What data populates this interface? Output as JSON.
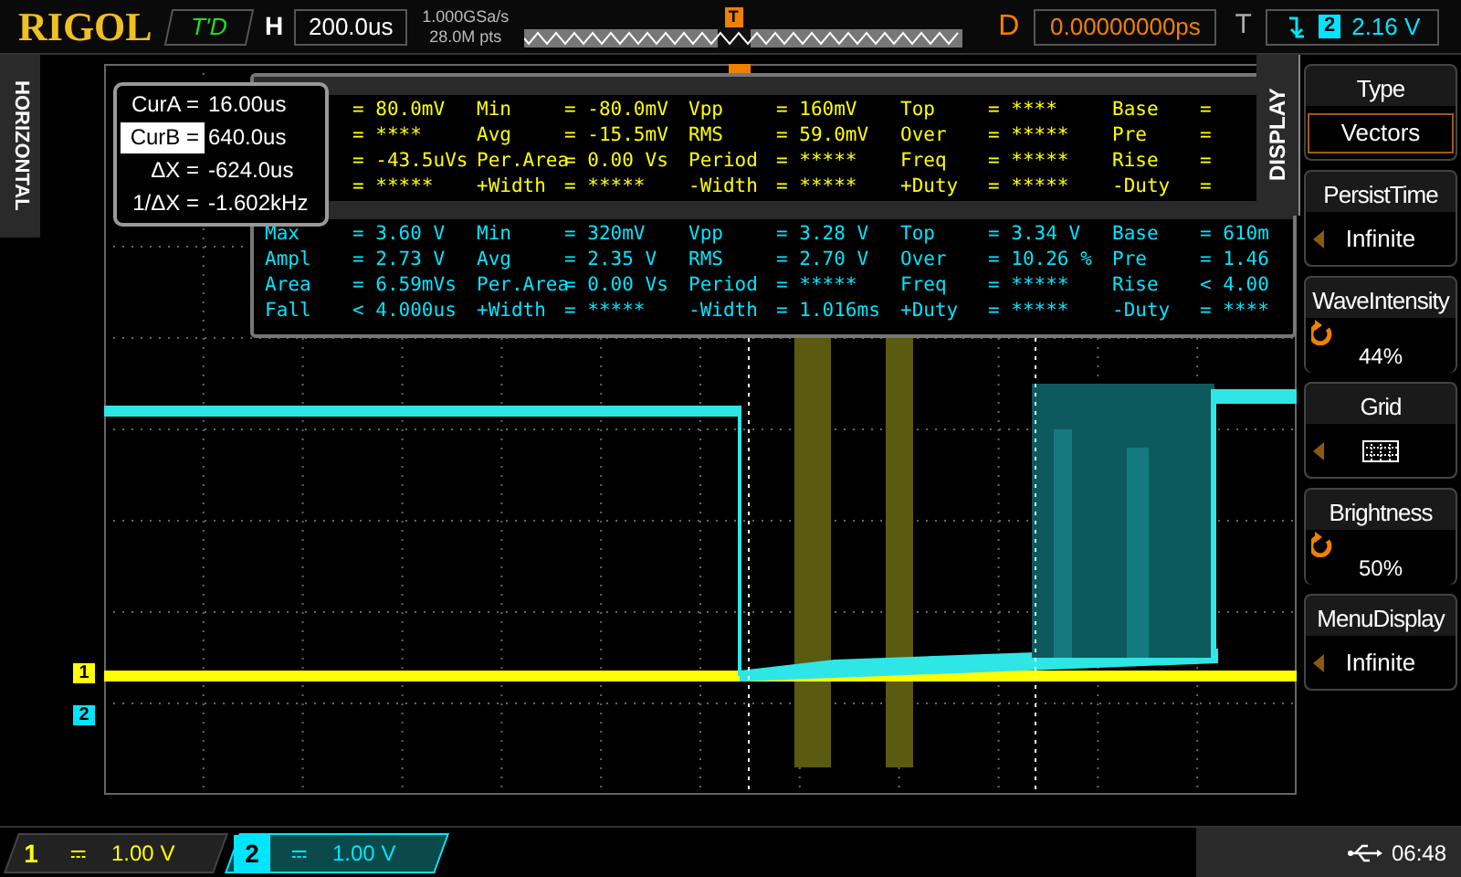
{
  "top_bar": {
    "logo": "RIGOL",
    "trigger_status": "T'D",
    "timebase_label": "H",
    "timebase": "200.0us",
    "sample_rate": "1.000GSa/s",
    "memory_depth": "28.0M pts",
    "trigger_marker": "T",
    "delay_label": "D",
    "delay": "0.00000000ps",
    "trigger_label": "T",
    "trigger_source": "2",
    "trigger_level": "2.16 V"
  },
  "side_tab": "HORIZONTAL",
  "channel_markers": [
    {
      "label": "1",
      "color": "#ffff00"
    },
    {
      "label": "2",
      "color": "#00e5ff"
    }
  ],
  "cursor_readout": [
    {
      "label": "CurA =",
      "value": "16.00us",
      "selected": false
    },
    {
      "label": "CurB =",
      "value": "640.0us",
      "selected": true
    },
    {
      "label": "ΔX =",
      "value": "-624.0us",
      "selected": false
    },
    {
      "label": "1/ΔX =",
      "value": "-1.602kHz",
      "selected": false
    }
  ],
  "measurements": [
    {
      "color": "#ffff00",
      "rows": [
        [
          {
            "value": "= 80.0mV"
          },
          {
            "label": "Min",
            "value": "= -80.0mV"
          },
          {
            "label": "Vpp",
            "value": "= 160mV"
          },
          {
            "label": "Top",
            "value": "= ****"
          },
          {
            "label": "Base",
            "value": "="
          }
        ],
        [
          {
            "value": "= ****"
          },
          {
            "label": "Avg",
            "value": "= -15.5mV"
          },
          {
            "label": "RMS",
            "value": "= 59.0mV"
          },
          {
            "label": "Over",
            "value": "= *****"
          },
          {
            "label": "Pre",
            "value": "="
          }
        ],
        [
          {
            "value": "= -43.5uVs"
          },
          {
            "label": "Per.Area",
            "value": "= 0.00 Vs"
          },
          {
            "label": "Period",
            "value": "= *****"
          },
          {
            "label": "Freq",
            "value": "= *****"
          },
          {
            "label": "Rise",
            "value": "="
          }
        ],
        [
          {
            "value": "= *****"
          },
          {
            "label": "+Width",
            "value": "= *****"
          },
          {
            "label": "-Width",
            "value": "= *****"
          },
          {
            "label": "+Duty",
            "value": "= *****"
          },
          {
            "label": "-Duty",
            "value": "="
          }
        ]
      ]
    },
    {
      "color": "#00e5ff",
      "rows": [
        [
          {
            "label": "Max",
            "value": "= 3.60 V"
          },
          {
            "label": "Min",
            "value": "= 320mV"
          },
          {
            "label": "Vpp",
            "value": "= 3.28 V"
          },
          {
            "label": "Top",
            "value": "= 3.34 V"
          },
          {
            "label": "Base",
            "value": "= 610m"
          }
        ],
        [
          {
            "label": "Ampl",
            "value": "= 2.73 V"
          },
          {
            "label": "Avg",
            "value": "= 2.35 V"
          },
          {
            "label": "RMS",
            "value": "= 2.70 V"
          },
          {
            "label": "Over",
            "value": "= 10.26 %"
          },
          {
            "label": "Pre",
            "value": "= 1.46"
          }
        ],
        [
          {
            "label": "Area",
            "value": "= 6.59mVs"
          },
          {
            "label": "Per.Area",
            "value": "= 0.00 Vs"
          },
          {
            "label": "Period",
            "value": "= *****"
          },
          {
            "label": "Freq",
            "value": "= *****"
          },
          {
            "label": "Rise",
            "value": "< 4.00"
          }
        ],
        [
          {
            "label": "Fall",
            "value": "< 4.000us"
          },
          {
            "label": "+Width",
            "value": "= *****"
          },
          {
            "label": "-Width",
            "value": "= 1.016ms"
          },
          {
            "label": "+Duty",
            "value": "= *****"
          },
          {
            "label": "-Duty",
            "value": "= ****"
          }
        ]
      ]
    }
  ],
  "menu": {
    "tab": "DISPLAY",
    "items": [
      {
        "title": "Type",
        "kind": "boxed",
        "value": "Vectors"
      },
      {
        "title": "PersistTime",
        "kind": "option",
        "value": "Infinite"
      },
      {
        "title": "WaveIntensity",
        "kind": "knob",
        "value": "44%"
      },
      {
        "title": "Grid",
        "kind": "grid"
      },
      {
        "title": "Brightness",
        "kind": "knob",
        "value": "50%"
      },
      {
        "title": "MenuDisplay",
        "kind": "option",
        "value": "Infinite"
      }
    ]
  },
  "channels": [
    {
      "label": "1",
      "scale": "1.00 V",
      "color": "#ffff00",
      "selected": false
    },
    {
      "label": "2",
      "scale": "1.00 V",
      "color": "#00e5ff",
      "selected": true
    }
  ],
  "clock": "06:48"
}
